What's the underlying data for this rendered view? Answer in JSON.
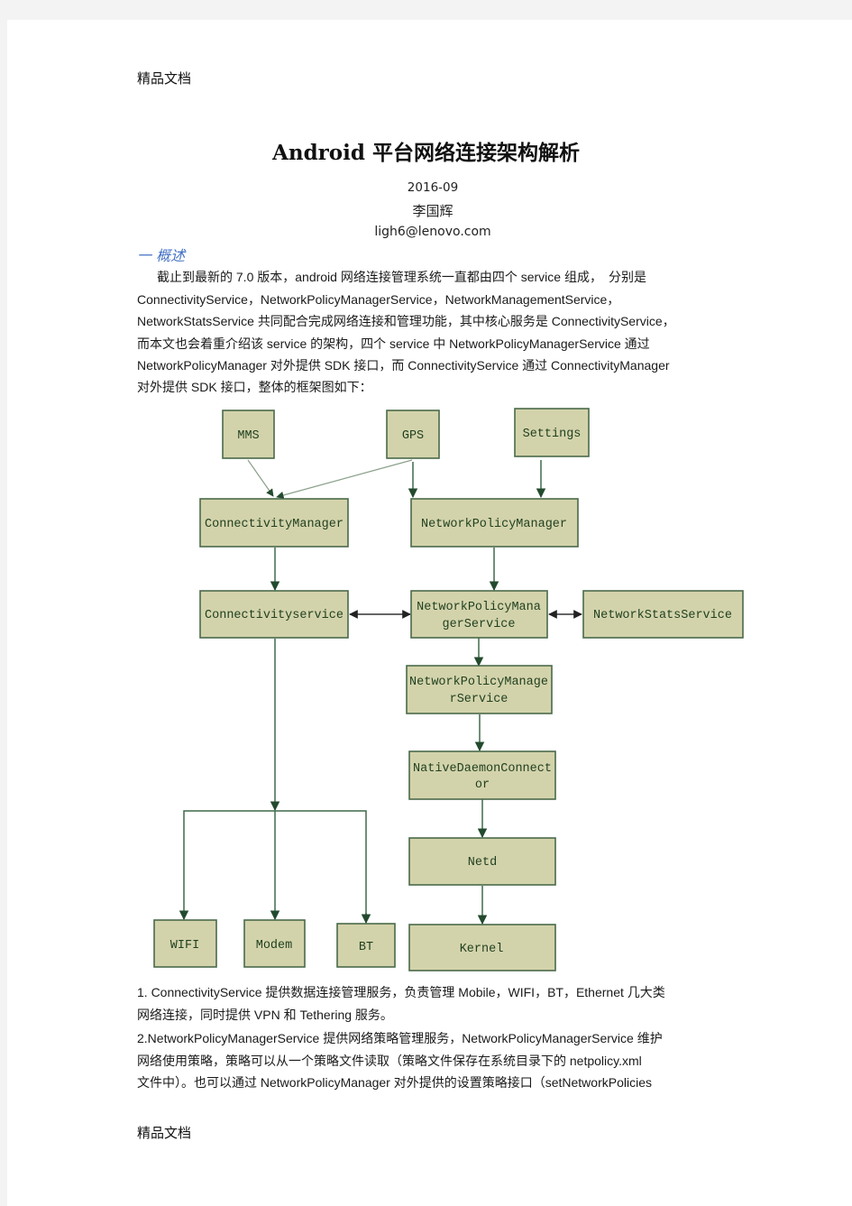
{
  "header": {
    "watermark": "精品文档"
  },
  "footer": {
    "watermark": "精品文档"
  },
  "document": {
    "title": "Android 平台网络连接架构解析",
    "date": "2016-09",
    "author": "李国辉",
    "email": "ligh6@lenovo.com",
    "section_heading": "一 概述",
    "intro_lines": [
      "截止到最新的 7.0 版本，android 网络连接管理系统一直都由四个 service 组成，　分别是",
      "ConnectivityService，NetworkPolicyManagerService，NetworkManagementService，",
      "NetworkStatsService 共同配合完成网络连接和管理功能，其中核心服务是 ConnectivityService，",
      "而本文也会着重介绍该 service 的架构，四个 service 中 NetworkPolicyManagerService 通过",
      "NetworkPolicyManager 对外提供 SDK 接口，而 ConnectivityService 通过 ConnectivityManager",
      "对外提供 SDK 接口，整体的框架图如下："
    ],
    "points_lines": [
      "1. ConnectivityService 提供数据连接管理服务，负责管理 Mobile，WIFI，BT，Ethernet 几大类",
      "网络连接，同时提供 VPN 和 Tethering 服务。",
      "2.NetworkPolicyManagerService 提供网络策略管理服务，NetworkPolicyManagerService 维护",
      "网络使用策略，策略可以从一个策略文件读取（策略文件保存在系统目录下的 netpolicy.xml",
      "文件中）。也可以通过 NetworkPolicyManager 对外提供的设置策略接口（setNetworkPolicies"
    ]
  },
  "diagram": {
    "nodes": {
      "mms": [
        "MMS"
      ],
      "gps": [
        "GPS"
      ],
      "settings": [
        "Settings"
      ],
      "connectivity_manager": [
        "ConnectivityManager"
      ],
      "network_policy_manager": [
        "NetworkPolicyManager"
      ],
      "connectivity_service": [
        "Connectivityservice"
      ],
      "npms_top": [
        "NetworkPolicyMana",
        "gerService"
      ],
      "network_stats_service": [
        "NetworkStatsService"
      ],
      "npms_mid": [
        "NetworkPolicyManage",
        "rService"
      ],
      "native_daemon_connector": [
        "NativeDaemonConnect",
        "or"
      ],
      "netd": [
        "Netd"
      ],
      "kernel": [
        "Kernel"
      ],
      "wifi": [
        "WIFI"
      ],
      "modem": [
        "Modem"
      ],
      "bt": [
        "BT"
      ]
    },
    "edges": [
      [
        "mms",
        "connectivity_manager"
      ],
      [
        "gps",
        "connectivity_manager"
      ],
      [
        "gps",
        "network_policy_manager"
      ],
      [
        "settings",
        "network_policy_manager"
      ],
      [
        "connectivity_manager",
        "connectivity_service"
      ],
      [
        "network_policy_manager",
        "npms_top"
      ],
      [
        "connectivity_service",
        "npms_top",
        "bidirectional"
      ],
      [
        "npms_top",
        "network_stats_service",
        "bidirectional"
      ],
      [
        "npms_top",
        "npms_mid"
      ],
      [
        "npms_mid",
        "native_daemon_connector"
      ],
      [
        "native_daemon_connector",
        "netd"
      ],
      [
        "netd",
        "kernel"
      ],
      [
        "connectivity_service",
        "wifi"
      ],
      [
        "connectivity_service",
        "modem"
      ],
      [
        "connectivity_service",
        "bt"
      ]
    ]
  }
}
